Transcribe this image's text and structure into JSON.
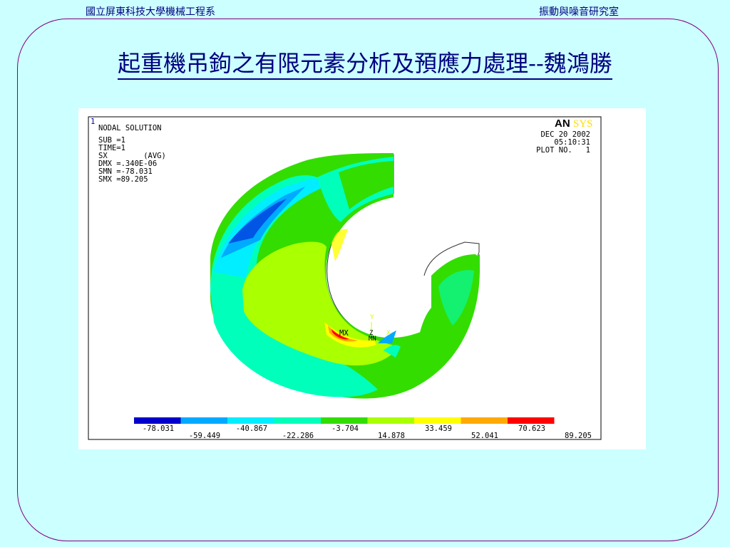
{
  "header": {
    "left": "國立屏東科技大學機械工程系",
    "right": "振動與噪音研究室"
  },
  "title": "起重機吊鉤之有限元素分析及預應力處理--魏鴻勝",
  "plot": {
    "corner_number": "1",
    "info_lines": [
      "NODAL SOLUTION",
      "SUB =1",
      "TIME=1",
      "SX        (AVG)",
      "DMX =.340E-06",
      "SMN =-78.031",
      "SMX =89.205"
    ],
    "logo": {
      "left": "AN",
      "right": "SYS"
    },
    "date": "DEC 20 2002",
    "time": "05:10:31",
    "plot_no": "PLOT NO.   1",
    "markers": {
      "mx": "MX",
      "mn": "MN",
      "y": "Y",
      "x": "X",
      "z": "Z"
    },
    "legend": {
      "colors": [
        "#0000cc",
        "#00aaff",
        "#00eeff",
        "#00ffbb",
        "#33dd00",
        "#aaff00",
        "#ffff00",
        "#ffaa00",
        "#ff0000"
      ],
      "labels_top": [
        "-78.031",
        "-40.867",
        "-3.704",
        "33.459",
        "70.623"
      ],
      "labels_bottom": [
        "-59.449",
        "-22.286",
        "14.878",
        "52.041",
        "89.205"
      ]
    }
  }
}
